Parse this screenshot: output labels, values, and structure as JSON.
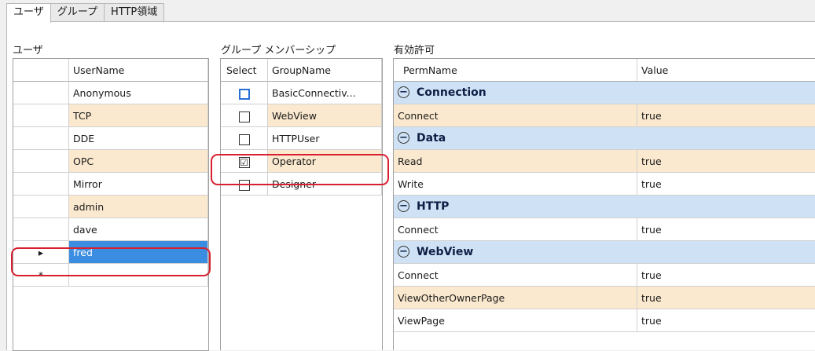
{
  "tabs": [
    "ユーザ",
    "グループ",
    "HTTP領域"
  ],
  "sections": {
    "users": "ユーザ",
    "membership": "グループ メンバーシップ",
    "permissions": "有効許可"
  },
  "users_grid": {
    "header": "UserName",
    "marker_selected": "▸",
    "marker_new": "*",
    "rows": [
      "Anonymous",
      "TCP",
      "DDE",
      "OPC",
      "Mirror",
      "admin",
      "dave",
      "fred"
    ]
  },
  "groups_grid": {
    "header_select": "Select",
    "header_name": "GroupName",
    "rows": [
      {
        "name": "BasicConnectiv...",
        "checked": false,
        "mark": ""
      },
      {
        "name": "WebView",
        "checked": false,
        "mark": ""
      },
      {
        "name": "HTTPUser",
        "checked": false,
        "mark": ""
      },
      {
        "name": "Operator",
        "checked": true,
        "mark": "☑"
      },
      {
        "name": "Designer",
        "checked": false,
        "mark": ""
      }
    ]
  },
  "perm_grid": {
    "header_name": "PermName",
    "header_value": "Value",
    "collapse_glyph": "−",
    "groups": [
      {
        "name": "Connection",
        "perms": [
          {
            "name": "Connect",
            "value": "true"
          }
        ]
      },
      {
        "name": "Data",
        "perms": [
          {
            "name": "Read",
            "value": "true"
          },
          {
            "name": "Write",
            "value": "true"
          }
        ]
      },
      {
        "name": "HTTP",
        "perms": [
          {
            "name": "Connect",
            "value": "true"
          }
        ]
      },
      {
        "name": "WebView",
        "perms": [
          {
            "name": "Connect",
            "value": "true"
          },
          {
            "name": "ViewOtherOwnerPage",
            "value": "true"
          },
          {
            "name": "ViewPage",
            "value": "true"
          }
        ]
      }
    ]
  },
  "colors": {
    "alt_row": "#fbe9cf",
    "selected_row": "#3a8de0",
    "group_header": "#cfe2f5",
    "highlight": "#d81f2f"
  }
}
